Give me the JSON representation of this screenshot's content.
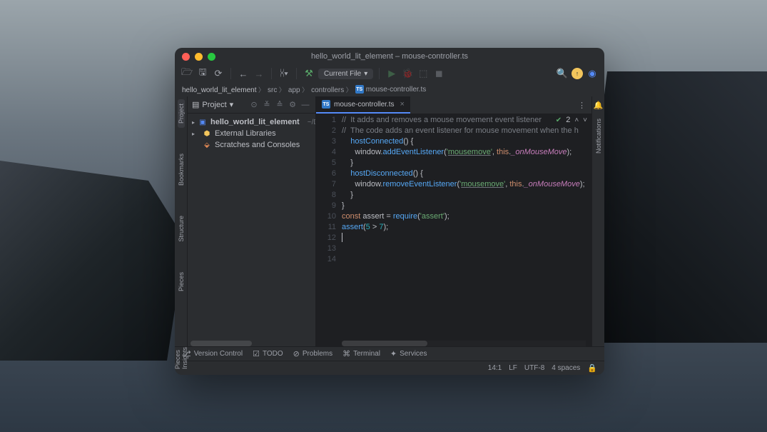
{
  "window_title": "hello_world_lit_element – mouse-controller.ts",
  "toolbar": {
    "current_file": "Current File"
  },
  "breadcrumb": [
    "hello_world_lit_element",
    "src",
    "app",
    "controllers",
    "mouse-controller.ts"
  ],
  "project": {
    "label": "Project",
    "tree": {
      "root": "hello_world_lit_element",
      "root_path": "~/Develop...",
      "external": "External Libraries",
      "scratches": "Scratches and Consoles"
    }
  },
  "left_tools": [
    "Project",
    "Bookmarks",
    "Structure",
    "Pieces",
    "Pieces Insights"
  ],
  "right_tools": [
    "Notifications"
  ],
  "tabs": [
    {
      "name": "mouse-controller.ts"
    }
  ],
  "editor": {
    "inspection_count": "2",
    "lines": [
      {
        "n": 1,
        "tokens": [
          [
            "c",
            "//  It adds and removes a mouse movement event listener"
          ]
        ]
      },
      {
        "n": 2,
        "tokens": [
          [
            "c",
            "//  The code adds an event listener for mouse movement when the h"
          ]
        ]
      },
      {
        "n": 3,
        "tokens": [
          [
            "p",
            "    "
          ],
          [
            "fn",
            "hostConnected"
          ],
          [
            "p",
            "() {"
          ]
        ]
      },
      {
        "n": 4,
        "tokens": [
          [
            "p",
            "      window."
          ],
          [
            "fn",
            "addEventListener"
          ],
          [
            "p",
            "("
          ],
          [
            "s",
            "'"
          ],
          [
            "su",
            "mousemove"
          ],
          [
            "s",
            "'"
          ],
          [
            "p",
            ", "
          ],
          [
            "k",
            "this"
          ],
          [
            "p",
            "."
          ],
          [
            "m",
            "_onMouseMove"
          ],
          [
            "p",
            ");"
          ]
        ]
      },
      {
        "n": 5,
        "tokens": [
          [
            "p",
            "    }"
          ]
        ]
      },
      {
        "n": 6,
        "tokens": [
          [
            "p",
            ""
          ]
        ]
      },
      {
        "n": 7,
        "tokens": [
          [
            "p",
            "    "
          ],
          [
            "fn",
            "hostDisconnected"
          ],
          [
            "p",
            "() {"
          ]
        ]
      },
      {
        "n": 8,
        "tokens": [
          [
            "p",
            "      window."
          ],
          [
            "fn",
            "removeEventListener"
          ],
          [
            "p",
            "("
          ],
          [
            "s",
            "'"
          ],
          [
            "su",
            "mousemove"
          ],
          [
            "s",
            "'"
          ],
          [
            "p",
            ", "
          ],
          [
            "k",
            "this"
          ],
          [
            "p",
            "."
          ],
          [
            "m",
            "_onMouseMove"
          ],
          [
            "p",
            ");"
          ]
        ]
      },
      {
        "n": 9,
        "tokens": [
          [
            "p",
            "    }"
          ]
        ]
      },
      {
        "n": 10,
        "tokens": [
          [
            "p",
            "}"
          ]
        ]
      },
      {
        "n": 11,
        "tokens": [
          [
            "k",
            "const "
          ],
          [
            "p",
            "assert = "
          ],
          [
            "fn",
            "require"
          ],
          [
            "p",
            "("
          ],
          [
            "s",
            "'assert'"
          ],
          [
            "p",
            ");"
          ]
        ]
      },
      {
        "n": 12,
        "tokens": [
          [
            "p",
            ""
          ]
        ]
      },
      {
        "n": 13,
        "tokens": [
          [
            "fn",
            "assert"
          ],
          [
            "p",
            "("
          ],
          [
            "n",
            "5"
          ],
          [
            "p",
            " > "
          ],
          [
            "n",
            "7"
          ],
          [
            "p",
            ");"
          ]
        ]
      },
      {
        "n": 14,
        "tokens": [
          [
            "cursor",
            ""
          ]
        ]
      }
    ]
  },
  "bottom_tools": [
    "Version Control",
    "TODO",
    "Problems",
    "Terminal",
    "Services"
  ],
  "status": {
    "pos": "14:1",
    "line_sep": "LF",
    "encoding": "UTF-8",
    "indent": "4 spaces"
  }
}
